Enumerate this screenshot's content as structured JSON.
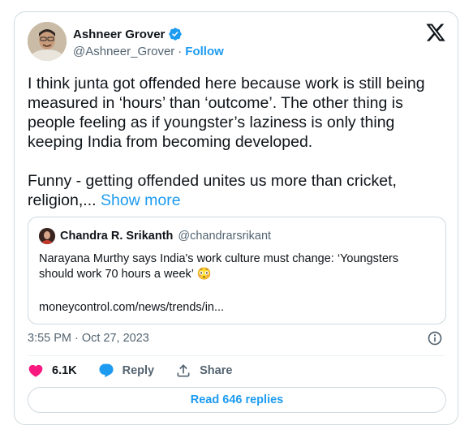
{
  "author": {
    "name": "Ashneer Grover",
    "handle": "@Ashneer_Grover",
    "separator": "·",
    "follow_label": "Follow"
  },
  "tweet": {
    "paragraph1": "I think junta got offended here because work is still being measured in ‘hours’ than ‘outcome’. The other thing is people feeling as if youngster’s laziness is only thing keeping India from becoming developed.",
    "paragraph2": "Funny - getting offended unites us more than cricket, religion,...",
    "show_more": "Show more"
  },
  "quote": {
    "name": "Chandra R. Srikanth",
    "handle": "@chandrarsrikant",
    "text": "Narayana Murthy says India's work culture must change: ‘Youngsters should work 70 hours a week’ 😳",
    "link": "moneycontrol.com/news/trends/in..."
  },
  "meta": {
    "time": "3:55 PM",
    "separator": "·",
    "date": "Oct 27, 2023"
  },
  "actions": {
    "likes": "6.1K",
    "reply_label": "Reply",
    "share_label": "Share"
  },
  "replies_button": "Read 646 replies",
  "colors": {
    "accent": "#1d9bf0",
    "like": "#f91880",
    "secondary_text": "#536471",
    "border": "#cfd9de"
  },
  "icons": [
    "verified-badge-icon",
    "x-logo-icon",
    "info-icon",
    "heart-icon",
    "reply-bubble-icon",
    "share-icon"
  ]
}
